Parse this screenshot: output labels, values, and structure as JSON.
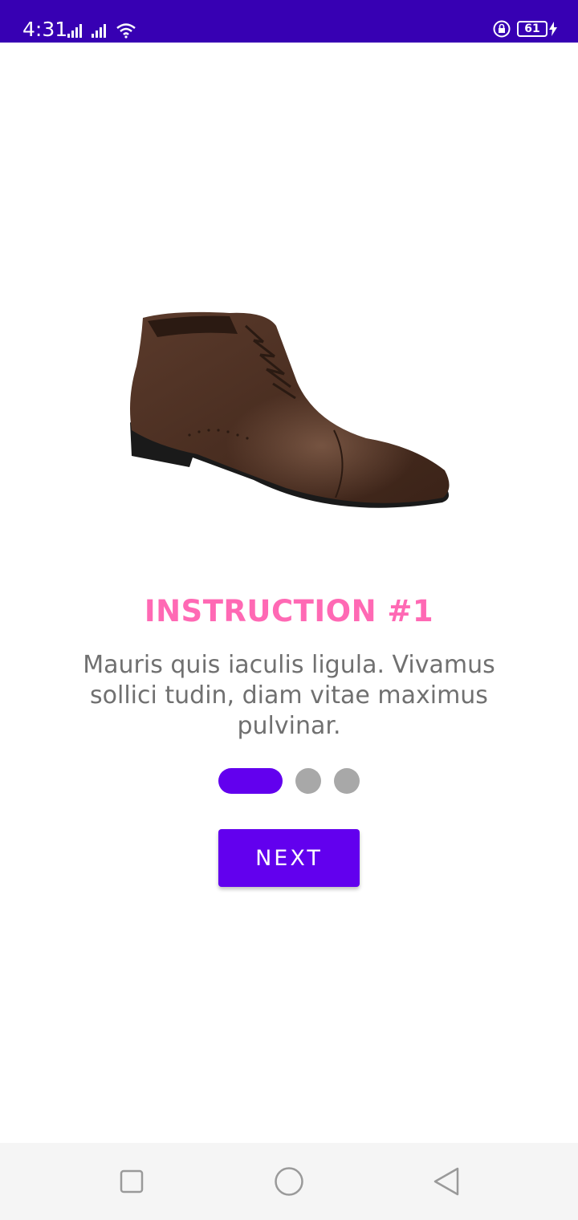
{
  "status_bar": {
    "time": "4:31",
    "battery_level": "61",
    "background": "#3700b3"
  },
  "onboarding": {
    "title": "INSTRUCTION #1",
    "description": "Mauris quis iaculis ligula. Vivamus sollici tudin, diam vitae maximus pulvinar.",
    "page_count": 3,
    "current_page": 1,
    "next_label": "NEXT",
    "colors": {
      "title": "#ff69b4",
      "accent": "#6200ee",
      "inactive_dot": "#a8a8a8",
      "description": "#707070"
    }
  },
  "nav_bar": {
    "buttons": [
      "square-recents-icon",
      "circle-home-icon",
      "triangle-back-icon"
    ]
  }
}
